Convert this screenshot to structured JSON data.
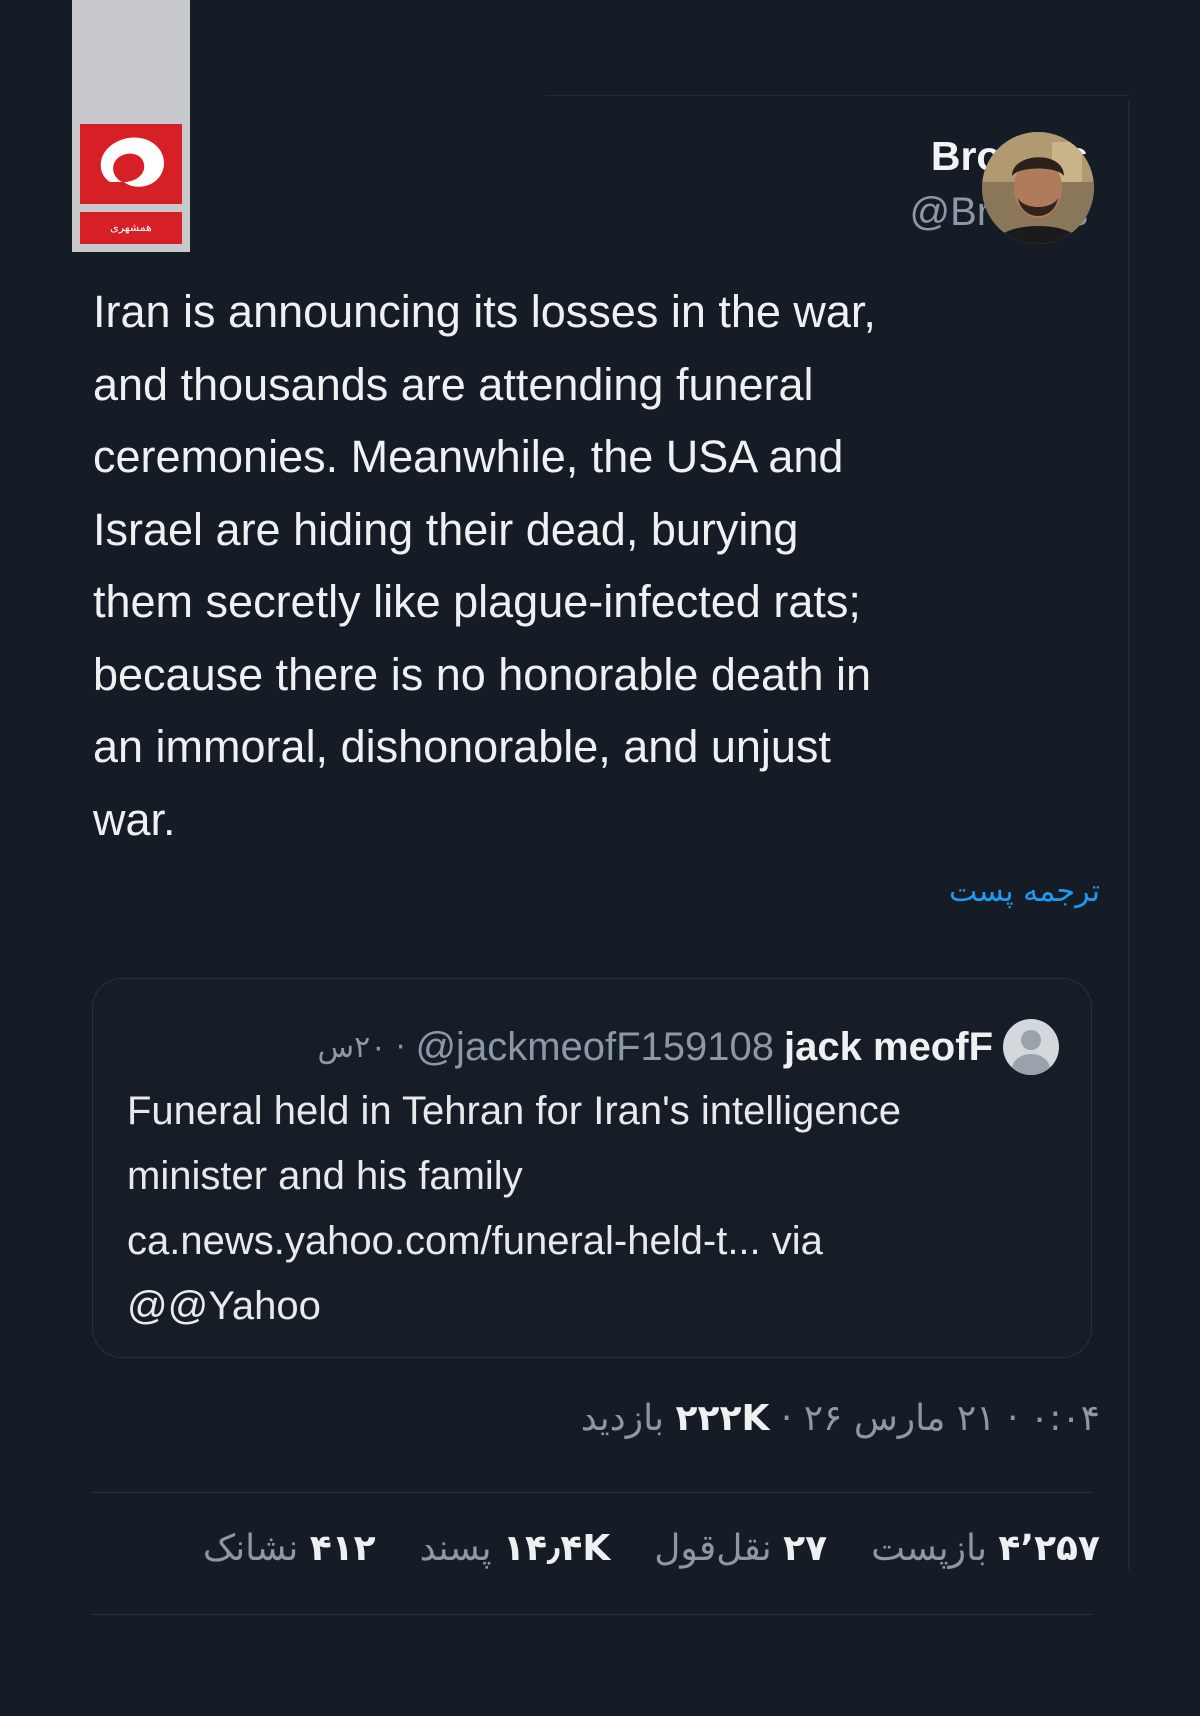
{
  "logo": {
    "strip_text": "همشهری"
  },
  "author": {
    "name": "Broufus",
    "handle": "@Broufus"
  },
  "post": {
    "lines": [
      "Iran is announcing its losses in the war,",
      "and thousands are attending funeral",
      "ceremonies. Meanwhile, the USA and",
      "Israel are hiding their dead, burying",
      "them secretly like plague-infected rats;",
      "because there is no honorable death in",
      "an immoral, dishonorable, and unjust",
      "war."
    ],
    "translate_label": "ترجمه پست"
  },
  "quote": {
    "name": "jack meofF",
    "handle": "@jackmeofF159108",
    "time": "· ۲۰س",
    "lines": [
      "Funeral held in Tehran for Iran's intelligence",
      "minister and his family",
      "ca.news.yahoo.com/funeral-held-t... via",
      "@@Yahoo"
    ]
  },
  "meta": {
    "time_date": "۰:۰۴ · ۲۱ مارس ۲۶ ·",
    "views_count": "۲۲۲K",
    "views_label": "بازدید"
  },
  "stats": [
    {
      "count": "۴٬۲۵۷",
      "label": "بازپست"
    },
    {
      "count": "۲۷",
      "label": "نقل‌قول"
    },
    {
      "count": "۱۴٫۴K",
      "label": "پسند"
    },
    {
      "count": "۴۱۲",
      "label": "نشانک"
    }
  ]
}
